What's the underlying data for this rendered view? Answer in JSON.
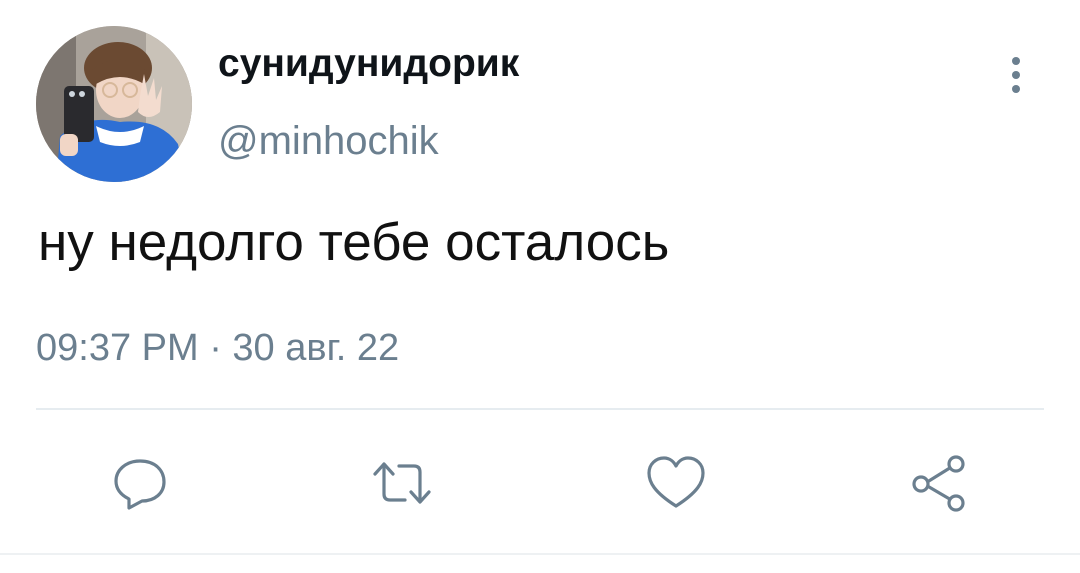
{
  "tweet": {
    "display_name": "сунидунидорик",
    "handle": "@minhochik",
    "text": "ну недолго тебе осталось",
    "timestamp": "09:37 PM · 30 авг. 22"
  },
  "icons": {
    "more": "more-vertical-icon",
    "reply": "reply-icon",
    "retweet": "retweet-icon",
    "like": "heart-icon",
    "share": "share-icon"
  },
  "colors": {
    "text": "#0f1419",
    "secondary": "#6b7f8f",
    "divider": "#e6ecf0",
    "icon": "#6b7f8f"
  }
}
